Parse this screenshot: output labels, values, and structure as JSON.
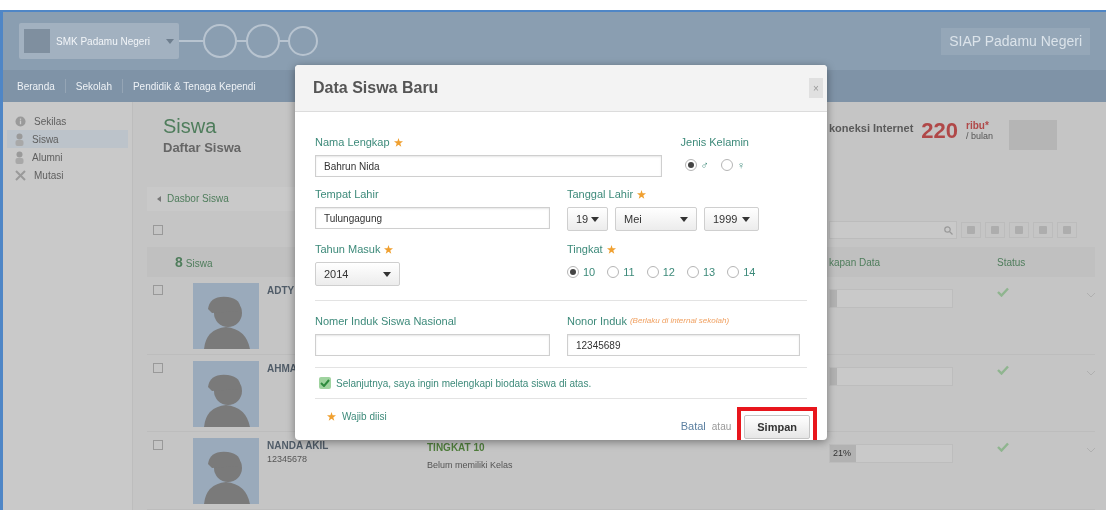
{
  "header": {
    "school": "SMK Padamu Negeri",
    "brand": "SIAP Padamu Negeri"
  },
  "nav": [
    {
      "label": "Beranda"
    },
    {
      "label": "Sekolah"
    },
    {
      "label": "Pendidik & Tenaga Kependi"
    }
  ],
  "sidebar": [
    {
      "label": "Sekilas",
      "kind": "info",
      "selected": false
    },
    {
      "label": "Siswa",
      "kind": "person",
      "selected": true
    },
    {
      "label": "Alumni",
      "kind": "person",
      "selected": false
    },
    {
      "label": "Mutasi",
      "kind": "cross",
      "selected": false
    }
  ],
  "page": {
    "title": "Siswa",
    "subtitle": "Daftar Siswa",
    "breadcrumb": "Dasbor Siswa",
    "select_all_checked": false,
    "count": "8",
    "count_label": "Siswa"
  },
  "promo": {
    "text": "koneksi Internet",
    "price": "220",
    "unit": "ribu*",
    "period": "/ bulan"
  },
  "table": {
    "columns": [
      {
        "label": "kapan Data"
      },
      {
        "label": "Status"
      }
    ],
    "rows": [
      {
        "name": "ADTY",
        "checked": false,
        "level": 0.06,
        "verified": true
      },
      {
        "name": "AHMA",
        "checked": false,
        "level": 0.06,
        "verified": true
      },
      {
        "name": "NANDA AKIL",
        "checked": false,
        "nis": "12345678",
        "grade": "TINGKAT 10",
        "class": "Belum memiliki Kelas",
        "reading": "21%",
        "level": 0.21,
        "verified": true
      }
    ]
  },
  "modal": {
    "title": "Data Siswa Baru",
    "close": "×",
    "nama": {
      "label": "Nama Lengkap",
      "required": true,
      "value": "Bahrun Nida"
    },
    "gender": {
      "label": "Jenis Kelamin",
      "required": false,
      "options": [
        {
          "label": "♂",
          "selected": true
        },
        {
          "label": "♀",
          "selected": false
        }
      ]
    },
    "tempat": {
      "label": "Tempat Lahir",
      "required": false,
      "value": "Tulungagung"
    },
    "tanggal": {
      "label": "Tanggal Lahir",
      "required": true,
      "day": "19",
      "month": "Mei",
      "year": "1999"
    },
    "tahun": {
      "label": "Tahun Masuk",
      "required": true,
      "value": "2014"
    },
    "tingkat": {
      "label": "Tingkat",
      "required": true,
      "options": [
        {
          "label": "10",
          "selected": true
        },
        {
          "label": "11",
          "selected": false
        },
        {
          "label": "12",
          "selected": false
        },
        {
          "label": "13",
          "selected": false
        },
        {
          "label": "14",
          "selected": false
        }
      ]
    },
    "nisn": {
      "label": "Nomer Induk Siswa Nasional",
      "required": false
    },
    "nomor": {
      "label": "Nonor Induk",
      "required": false,
      "note": "(Berlaku di internal sekolah)",
      "value": "12345689"
    },
    "confirm": {
      "label": "Selanjutnya, saya ingin melengkapi biodata siswa di atas.",
      "checked": true
    },
    "legend": "Wajib diisi",
    "cancel": "Batal",
    "or": "atau",
    "submit": "Simpan"
  }
}
